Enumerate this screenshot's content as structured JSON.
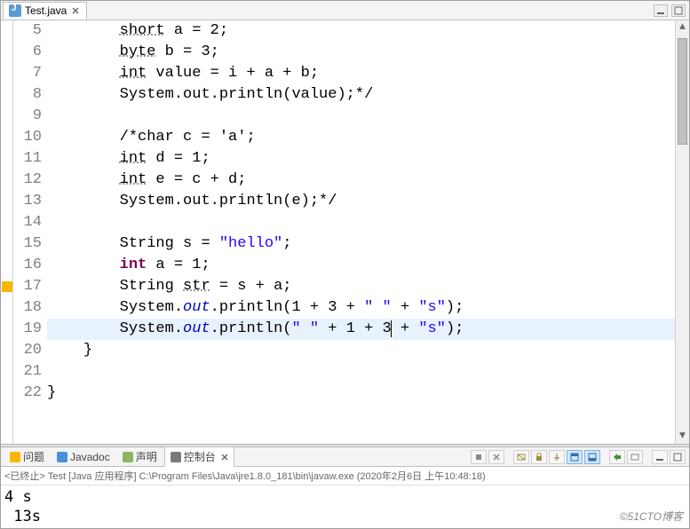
{
  "editor": {
    "tab_label": "Test.java",
    "first_line_no": 5
  },
  "code_lines": [
    {
      "seg": [
        {
          "c": "und",
          "t": "short"
        },
        {
          "c": "",
          "t": " a = 2;"
        }
      ],
      "indent": 8
    },
    {
      "seg": [
        {
          "c": "und",
          "t": "byte"
        },
        {
          "c": "",
          "t": " b = 3;"
        }
      ],
      "indent": 8
    },
    {
      "seg": [
        {
          "c": "und",
          "t": "int"
        },
        {
          "c": "",
          "t": " value = i + a + b;"
        }
      ],
      "indent": 8
    },
    {
      "seg": [
        {
          "c": "",
          "t": "System.out.println(value);*/"
        }
      ],
      "indent": 8
    },
    {
      "seg": [],
      "indent": 8
    },
    {
      "seg": [
        {
          "c": "",
          "t": "/*char c = 'a';"
        }
      ],
      "indent": 8
    },
    {
      "seg": [
        {
          "c": "und",
          "t": "int"
        },
        {
          "c": "",
          "t": " d = 1;"
        }
      ],
      "indent": 8
    },
    {
      "seg": [
        {
          "c": "und",
          "t": "int"
        },
        {
          "c": "",
          "t": " e = c + d;"
        }
      ],
      "indent": 8
    },
    {
      "seg": [
        {
          "c": "",
          "t": "System.out.println(e);*/"
        }
      ],
      "indent": 8
    },
    {
      "seg": [],
      "indent": 8
    },
    {
      "seg": [
        {
          "c": "",
          "t": "String s = "
        },
        {
          "c": "str",
          "t": "\"hello\""
        },
        {
          "c": "",
          "t": ";"
        }
      ],
      "indent": 8
    },
    {
      "seg": [
        {
          "c": "kw",
          "t": "int"
        },
        {
          "c": "",
          "t": " a = 1;"
        }
      ],
      "indent": 8
    },
    {
      "seg": [
        {
          "c": "",
          "t": "String "
        },
        {
          "c": "und",
          "t": "str"
        },
        {
          "c": "",
          "t": " = s + a;"
        }
      ],
      "indent": 8,
      "mark": true
    },
    {
      "seg": [
        {
          "c": "",
          "t": "System."
        },
        {
          "c": "sfield",
          "t": "out"
        },
        {
          "c": "",
          "t": ".println(1 + 3 + "
        },
        {
          "c": "str",
          "t": "\" \""
        },
        {
          "c": "",
          "t": " + "
        },
        {
          "c": "str",
          "t": "\"s\""
        },
        {
          "c": "",
          "t": ");"
        }
      ],
      "indent": 8
    },
    {
      "seg": [
        {
          "c": "",
          "t": "System."
        },
        {
          "c": "sfield",
          "t": "out"
        },
        {
          "c": "",
          "t": ".println("
        },
        {
          "c": "str",
          "t": "\" \""
        },
        {
          "c": "",
          "t": " + 1 + 3"
        },
        {
          "c": "cursor",
          "t": ""
        },
        {
          "c": "",
          "t": " + "
        },
        {
          "c": "str",
          "t": "\"s\""
        },
        {
          "c": "",
          "t": ");"
        }
      ],
      "indent": 8,
      "hl": true
    },
    {
      "seg": [
        {
          "c": "",
          "t": "}"
        }
      ],
      "indent": 4
    },
    {
      "seg": [],
      "indent": 0
    },
    {
      "seg": [
        {
          "c": "",
          "t": "}"
        }
      ],
      "indent": 0
    }
  ],
  "bottom": {
    "tabs": {
      "problems": "问题",
      "javadoc": "Javadoc",
      "declaration": "声明",
      "console": "控制台"
    },
    "status": "<已终止> Test [Java 应用程序] C:\\Program Files\\Java\\jre1.8.0_181\\bin\\javaw.exe (2020年2月6日 上午10:48:18)",
    "output": "4 s\n 13s"
  },
  "watermark": "©51CTO博客"
}
